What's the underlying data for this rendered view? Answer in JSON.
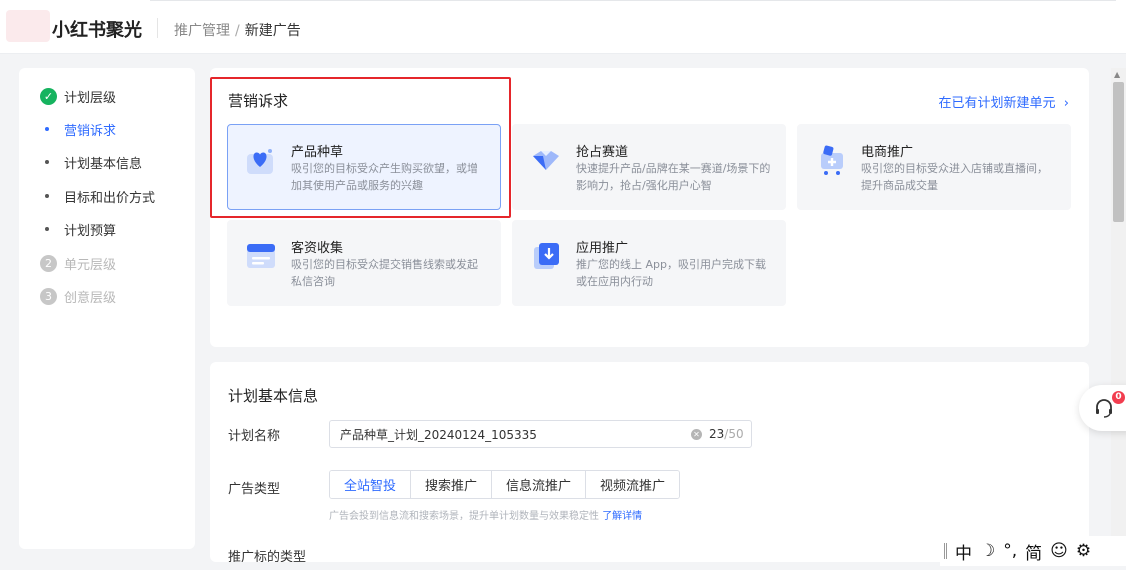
{
  "header": {
    "logo": "小红书聚光",
    "breadcrumb": {
      "parent": "推广管理",
      "separator": "/",
      "current": "新建广告"
    }
  },
  "sidebar": {
    "steps": [
      {
        "label": "计划层级",
        "status": "done"
      },
      {
        "number": "2",
        "label": "单元层级",
        "status": "pending"
      },
      {
        "number": "3",
        "label": "创意层级",
        "status": "pending"
      }
    ],
    "sub_items": [
      {
        "label": "营销诉求",
        "active": true
      },
      {
        "label": "计划基本信息"
      },
      {
        "label": "目标和出价方式"
      },
      {
        "label": "计划预算"
      }
    ]
  },
  "marketing": {
    "title": "营销诉求",
    "link": "在已有计划新建单元",
    "cards": [
      {
        "title": "产品种草",
        "desc": "吸引您的目标受众产生购买欲望，或增加其使用产品或服务的兴趣",
        "selected": true,
        "icon": "heart-bag-icon"
      },
      {
        "title": "抢占赛道",
        "desc": "快速提升产品/品牌在某一赛道/场景下的影响力，抢占/强化用户心智",
        "icon": "diamond-icon"
      },
      {
        "title": "电商推广",
        "desc": "吸引您的目标受众进入店铺或直播间，提升商品成交量",
        "icon": "shopping-cart-icon"
      },
      {
        "title": "客资收集",
        "desc": "吸引您的目标受众提交销售线索或发起私信咨询",
        "icon": "form-card-icon"
      },
      {
        "title": "应用推广",
        "desc": "推广您的线上 App，吸引用户完成下载或在应用内行动",
        "icon": "app-download-icon"
      }
    ]
  },
  "basic_info": {
    "title": "计划基本信息",
    "name_label": "计划名称",
    "name_value": "产品种草_计划_20240124_105335",
    "char_count": "23",
    "char_max": "/50",
    "ad_type_label": "广告类型",
    "ad_types": [
      "全站智投",
      "搜索推广",
      "信息流推广",
      "视频流推广"
    ],
    "ad_type_selected": 0,
    "hint": "广告会投到信息流和搜索场景，提升单计划数量与效果稳定性",
    "hint_link": "了解详情",
    "next_label": "推广标的类型"
  },
  "support": {
    "badge": "0"
  },
  "ime": {
    "items": [
      "中",
      "☽",
      "°,",
      "简",
      "☺",
      "⚙"
    ]
  },
  "colors": {
    "primary": "#2f6bff",
    "success": "#16b35f",
    "highlight": "#e5262b",
    "badge": "#f23d4f"
  }
}
